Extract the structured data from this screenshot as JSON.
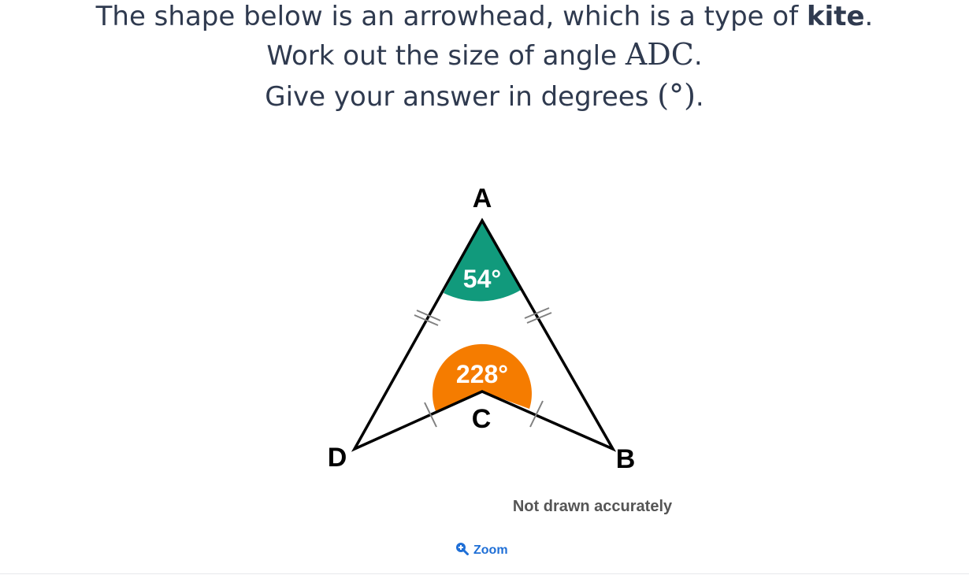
{
  "question": {
    "line1_prefix": "The shape below is an arrowhead, which is a type of ",
    "line1_bold": "kite",
    "line1_suffix": ".",
    "line2_prefix": "Work out the size of angle ",
    "line2_math": "ADC",
    "line2_suffix": ".",
    "line3_prefix": "Give your answer in degrees ",
    "line3_math": "(°)",
    "line3_suffix": "."
  },
  "diagram": {
    "vertex_labels": {
      "A": "A",
      "B": "B",
      "C": "C",
      "D": "D"
    },
    "angle_A": "54°",
    "angle_C": "228°",
    "note": "Not drawn accurately",
    "colors": {
      "angle_A_fill": "#119a7c",
      "angle_C_fill": "#f57c00",
      "outline": "#000000",
      "tick_marks": "#808080"
    }
  },
  "zoom_label": "Zoom",
  "zoom_icon": "zoom-in-magnifier-icon"
}
